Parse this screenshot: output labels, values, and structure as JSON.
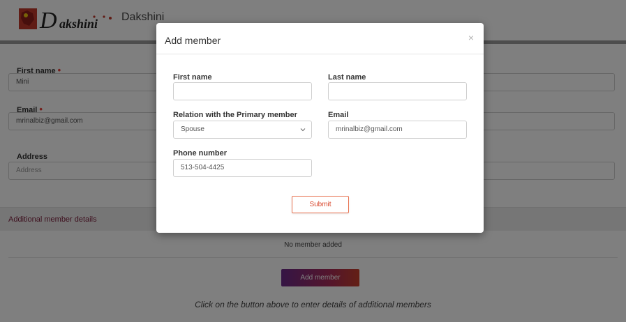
{
  "header": {
    "brand_text": "Dakshini"
  },
  "form": {
    "first_name": {
      "label": "First name",
      "value": "Mini"
    },
    "email": {
      "label": "Email",
      "value": "mrinalbiz@gmail.com"
    },
    "address": {
      "label": "Address",
      "placeholder": "Address"
    }
  },
  "additional": {
    "section_title": "Additional member details",
    "empty_text": "No member added",
    "add_button": "Add member",
    "hint": "Click on the button above to enter details of additional members"
  },
  "modal": {
    "title": "Add member",
    "close": "×",
    "first_name_label": "First name",
    "first_name_value": "",
    "last_name_label": "Last name",
    "last_name_value": "",
    "relation_label": "Relation with the Primary member",
    "relation_value": "Spouse",
    "email_label": "Email",
    "email_value": "mrinalbiz@gmail.com",
    "phone_label": "Phone number",
    "phone_value": "513-504-4425",
    "submit": "Submit"
  },
  "colors": {
    "required": "#e8413b",
    "section_title": "#7b1d3a",
    "submit_border": "#e8714f"
  }
}
